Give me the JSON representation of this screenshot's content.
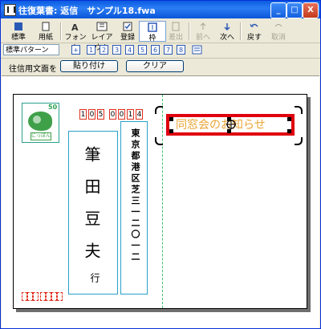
{
  "window": {
    "title": "往復葉書: 返信　サンプル18.fwa",
    "controls": {
      "minimize": "_",
      "maximize": "□",
      "close": "X"
    }
  },
  "toolbar": {
    "items": [
      {
        "label": "標準",
        "icon": "standard-icon"
      },
      {
        "label": "用紙",
        "icon": "paper-icon"
      },
      {
        "label": "フォント",
        "icon": "font-icon"
      },
      {
        "label": "レイアウト",
        "icon": "layout-icon"
      },
      {
        "label": "登録",
        "icon": "register-icon"
      },
      {
        "label": "枠",
        "icon": "frame-icon"
      },
      {
        "label": "差出",
        "icon": "sender-icon"
      },
      {
        "label": "前へ",
        "icon": "prev-icon"
      },
      {
        "label": "次へ",
        "icon": "next-icon"
      },
      {
        "label": "戻す",
        "icon": "undo-icon"
      },
      {
        "label": "取消",
        "icon": "cancel-icon"
      }
    ]
  },
  "pattern_bar": {
    "selected_pattern": "標準パターン",
    "numbers": [
      "1",
      "2",
      "3",
      "4",
      "5",
      "6",
      "7",
      "8"
    ]
  },
  "reply_bar": {
    "label": "往信用文面を",
    "paste_button": "貼り付け",
    "clear_button": "クリア"
  },
  "postcard": {
    "stamp_value": "50",
    "stamp_label": "にっぽん",
    "zip_digits": [
      "1",
      "0",
      "5",
      "0",
      "0",
      "1",
      "4"
    ],
    "recipient_name": "筆田豆夫",
    "honorific": "行",
    "address": "東京都港区芝三一二〇一二",
    "selected_text": "同窓会のお知らせ"
  },
  "colors": {
    "selection_border": "#E0000E",
    "selected_text": "#E9A436",
    "zip_border": "#E0301E",
    "field_border": "#2BA0C8",
    "fold_line": "#3DBF6A"
  }
}
